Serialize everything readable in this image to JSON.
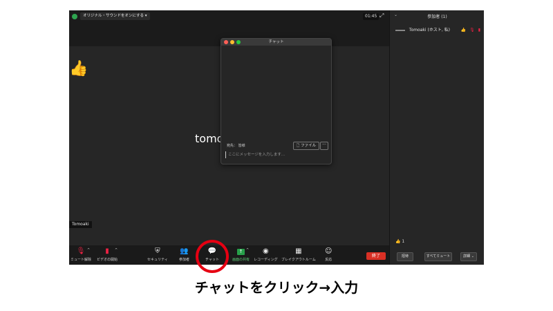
{
  "topbar": {
    "original_sound": "オリジナル・サウンドをオンにする ▾",
    "timer": "01:45",
    "expand_icon": "expand-icon"
  },
  "video": {
    "reaction": "👍",
    "participant_name_partial": "tomo",
    "name_tag": "Tomoaki"
  },
  "toolbar": {
    "mute": "ミュート解除",
    "video": "ビデオの開始",
    "security": "セキュリティ",
    "participants": "参加者",
    "chat": "チャット",
    "share": "画面の共有",
    "recording": "レコーディング",
    "breakout": "ブレイクアウトルーム",
    "reactions": "反応",
    "end": "終了"
  },
  "chat": {
    "title": "チャット",
    "to_label": "宛先： 皆様",
    "file_button": "ファイル",
    "more_button": "···",
    "placeholder": "ここにメッセージを入力します..."
  },
  "sidebar": {
    "title": "参加者 (1)",
    "participant": "Tomoaki (ホスト, 私)",
    "reaction": "👍 1",
    "invite": "招待",
    "mute_all": "すべてミュート",
    "more": "詳細 ⌄"
  },
  "caption": "チャットをクリック→入力"
}
